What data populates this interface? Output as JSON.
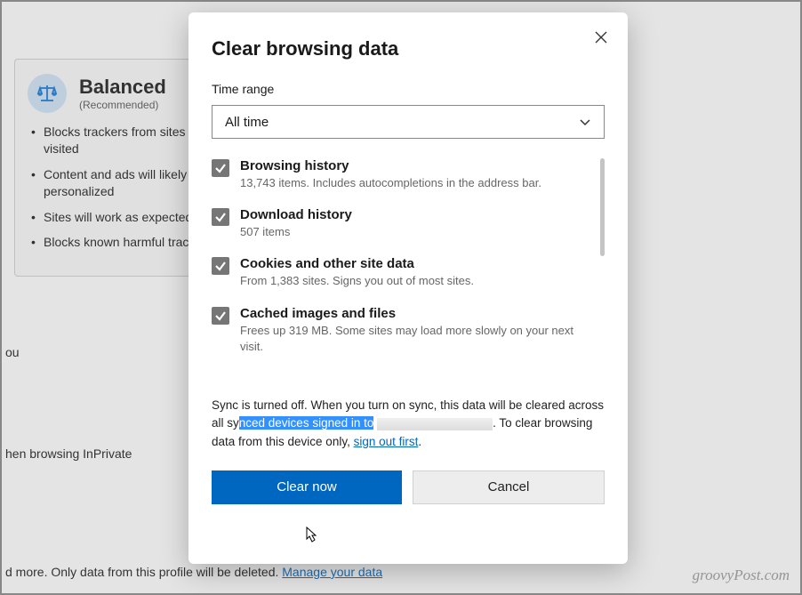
{
  "background": {
    "card": {
      "title": "Balanced",
      "subtitle": "(Recommended)",
      "items": [
        "Blocks trackers from sites you haven't visited",
        "Content and ads will likely be less personalized",
        "Sites will work as expected",
        "Blocks known harmful trackers"
      ]
    },
    "text_ou": "ou",
    "text_inprivate": "hen browsing InPrivate",
    "footer_prefix": "d more. Only data from this profile will be deleted. ",
    "footer_link": "Manage your data"
  },
  "dialog": {
    "title": "Clear browsing data",
    "time_range_label": "Time range",
    "time_range_value": "All time",
    "options": [
      {
        "title": "Browsing history",
        "desc": "13,743 items. Includes autocompletions in the address bar.",
        "checked": true
      },
      {
        "title": "Download history",
        "desc": "507 items",
        "checked": true
      },
      {
        "title": "Cookies and other site data",
        "desc": "From 1,383 sites. Signs you out of most sites.",
        "checked": true
      },
      {
        "title": "Cached images and files",
        "desc": "Frees up 319 MB. Some sites may load more slowly on your next visit.",
        "checked": true
      }
    ],
    "sync_note": {
      "p1": "Sync is turned off. When you turn on sync, this data will be cleared across all sy",
      "highlight": "nced devices signed in to",
      "p2": ". To clear browsing data from this device only, ",
      "link": "sign out first",
      "p3": "."
    },
    "buttons": {
      "primary": "Clear now",
      "secondary": "Cancel"
    }
  },
  "watermark": "groovyPost.com"
}
